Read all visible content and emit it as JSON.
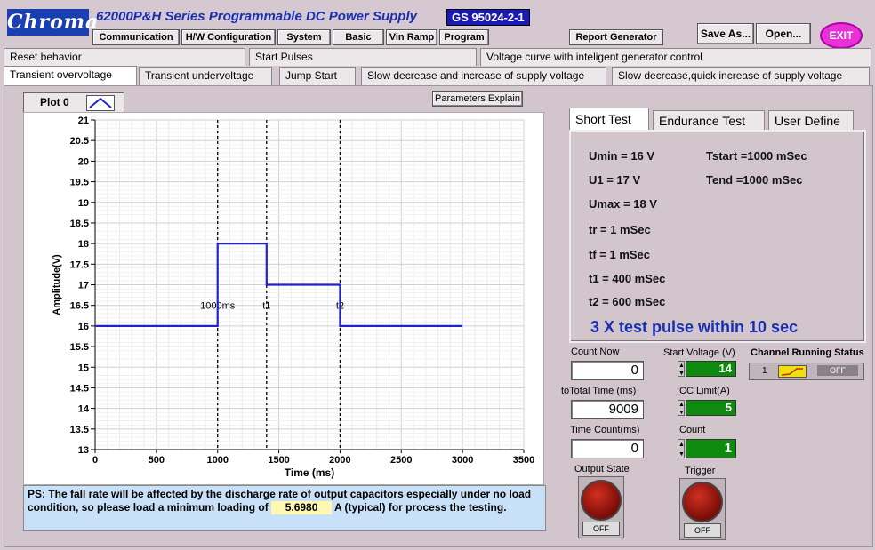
{
  "header": {
    "logo": "Chroma",
    "title": "62000P&H Series  Programmable DC Power Supply",
    "standard": "GS 95024-2-1"
  },
  "menu": [
    {
      "label": "Communication"
    },
    {
      "label": "H/W Configuration"
    },
    {
      "label": "System"
    },
    {
      "label": "Basic"
    },
    {
      "label": "Vin Ramp"
    },
    {
      "label": "Program"
    }
  ],
  "toolbar": {
    "report_label": "Report Generator",
    "save_label": "Save As...",
    "open_label": "Open...",
    "exit_label": "EXIT"
  },
  "tabs_row1": [
    {
      "label": "Reset behavior"
    },
    {
      "label": "Start Pulses"
    },
    {
      "label": "Voltage curve with inteligent generator control"
    }
  ],
  "tabs_row2": [
    {
      "label": "Transient overvoltage"
    },
    {
      "label": "Transient undervoltage"
    },
    {
      "label": "Jump Start"
    },
    {
      "label": "Slow decrease and increase of supply voltage"
    },
    {
      "label": "Slow decrease,quick increase of supply voltage"
    }
  ],
  "plot": {
    "legend_label": "Plot 0",
    "params_button": "Parameters Explain"
  },
  "chart_data": {
    "type": "line",
    "xlabel": "Time (ms)",
    "ylabel": "Amplitude(V)",
    "xlim": [
      0,
      3500
    ],
    "ylim": [
      13,
      21
    ],
    "xticks": [
      0,
      500,
      1000,
      1500,
      2000,
      2500,
      3000,
      3500
    ],
    "yticks": [
      13,
      13.5,
      14,
      14.5,
      15,
      15.5,
      16,
      16.5,
      17,
      17.5,
      18,
      18.5,
      19,
      19.5,
      20,
      20.5,
      21
    ],
    "grid": true,
    "series": [
      {
        "color": "#2222cc",
        "x": [
          0,
          1000,
          1000,
          1400,
          1400,
          2000,
          2000,
          3000
        ],
        "y": [
          16,
          16,
          18,
          18,
          17,
          17,
          16,
          16
        ]
      }
    ],
    "markers": [
      {
        "x": 1000,
        "label": "1000ms"
      },
      {
        "x": 1400,
        "label": "t1"
      },
      {
        "x": 2000,
        "label": "t2"
      }
    ]
  },
  "note": {
    "text_before": "PS: The fall rate will be affected by the discharge rate of output capacitors especially under no load condition, so please load a minimum loading of",
    "value": "5.6980",
    "text_after": "A (typical) for process the testing."
  },
  "right_tabs": [
    {
      "label": "Short Test"
    },
    {
      "label": "Endurance Test"
    },
    {
      "label": "User Define"
    }
  ],
  "params": {
    "umin": "Umin = 16 V",
    "u1": "U1 = 17 V",
    "umax": "Umax = 18 V",
    "tr": "tr = 1 mSec",
    "tf": "tf = 1 mSec",
    "t1": "t1 = 400 mSec",
    "t2": "t2 = 600 mSec",
    "tstart": "Tstart =1000 mSec",
    "tend": "Tend =1000 mSec",
    "pulse": "3 X test pulse within 10 sec"
  },
  "status": {
    "count_now_label": "Count Now",
    "count_now": "0",
    "total_time_label": "toTotal Time (ms)",
    "total_time": "9009",
    "time_count_label": "Time Count(ms)",
    "time_count": "0",
    "start_voltage_label": "Start Voltage (V)",
    "start_voltage": "14",
    "cc_limit_label": "CC Limit(A)",
    "cc_limit": "5",
    "count_label": "Count",
    "count": "1",
    "channel_label": "Channel Running Status",
    "channel_num": "1",
    "channel_state": "OFF",
    "output_state_label": "Output State",
    "output_state": "OFF",
    "trigger_label": "Trigger",
    "trigger_state": "OFF"
  }
}
